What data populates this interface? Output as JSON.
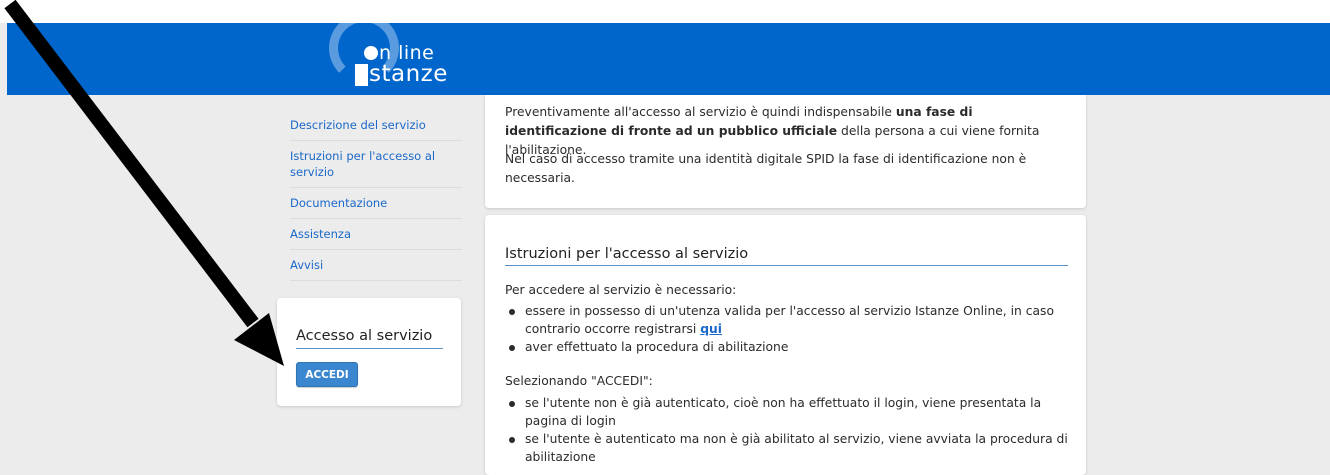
{
  "header": {
    "logo_top": "n line",
    "logo_bottom": "stanze",
    "logo_initials": "IO",
    "brand_color": "#0066cc"
  },
  "sidebar": {
    "items": [
      {
        "label": "Descrizione del servizio"
      },
      {
        "label": "Istruzioni per l'accesso al servizio"
      },
      {
        "label": "Documentazione"
      },
      {
        "label": "Assistenza"
      },
      {
        "label": "Avvisi"
      }
    ]
  },
  "access_box": {
    "title": "Accesso al servizio",
    "button_label": "ACCEDI"
  },
  "intro_card": {
    "p1_start": "Preventivamente all'accesso al servizio è quindi indispensabile ",
    "p1_bold": "una fase di identificazione di fronte ad un pubblico ufficiale",
    "p1_end": " della persona a cui viene fornita l'abilitazione.",
    "p2": "Nel caso di accesso tramite una identità digitale SPID la fase di identificazione non è necessaria."
  },
  "instructions_card": {
    "title": "Istruzioni per l'accesso al servizio",
    "intro": "Per accedere al servizio è necessario:",
    "req1_text": "essere in possesso di un'utenza valida per l'accesso al servizio Istanze Online, in caso contrario occorre registrarsi ",
    "req1_link": "qui",
    "req2": "aver effettuato la procedura di abilitazione",
    "selecting": "Selezionando \"ACCEDI\":",
    "case1": "se l'utente non è già autenticato, cioè non ha effettuato il login, viene presentata la pagina di login",
    "case2": "se l'utente è autenticato ma non è già abilitato al servizio, viene avviata la procedura di abilitazione"
  },
  "annotation": {
    "icon": "arrow-annotation",
    "color": "#000000"
  }
}
